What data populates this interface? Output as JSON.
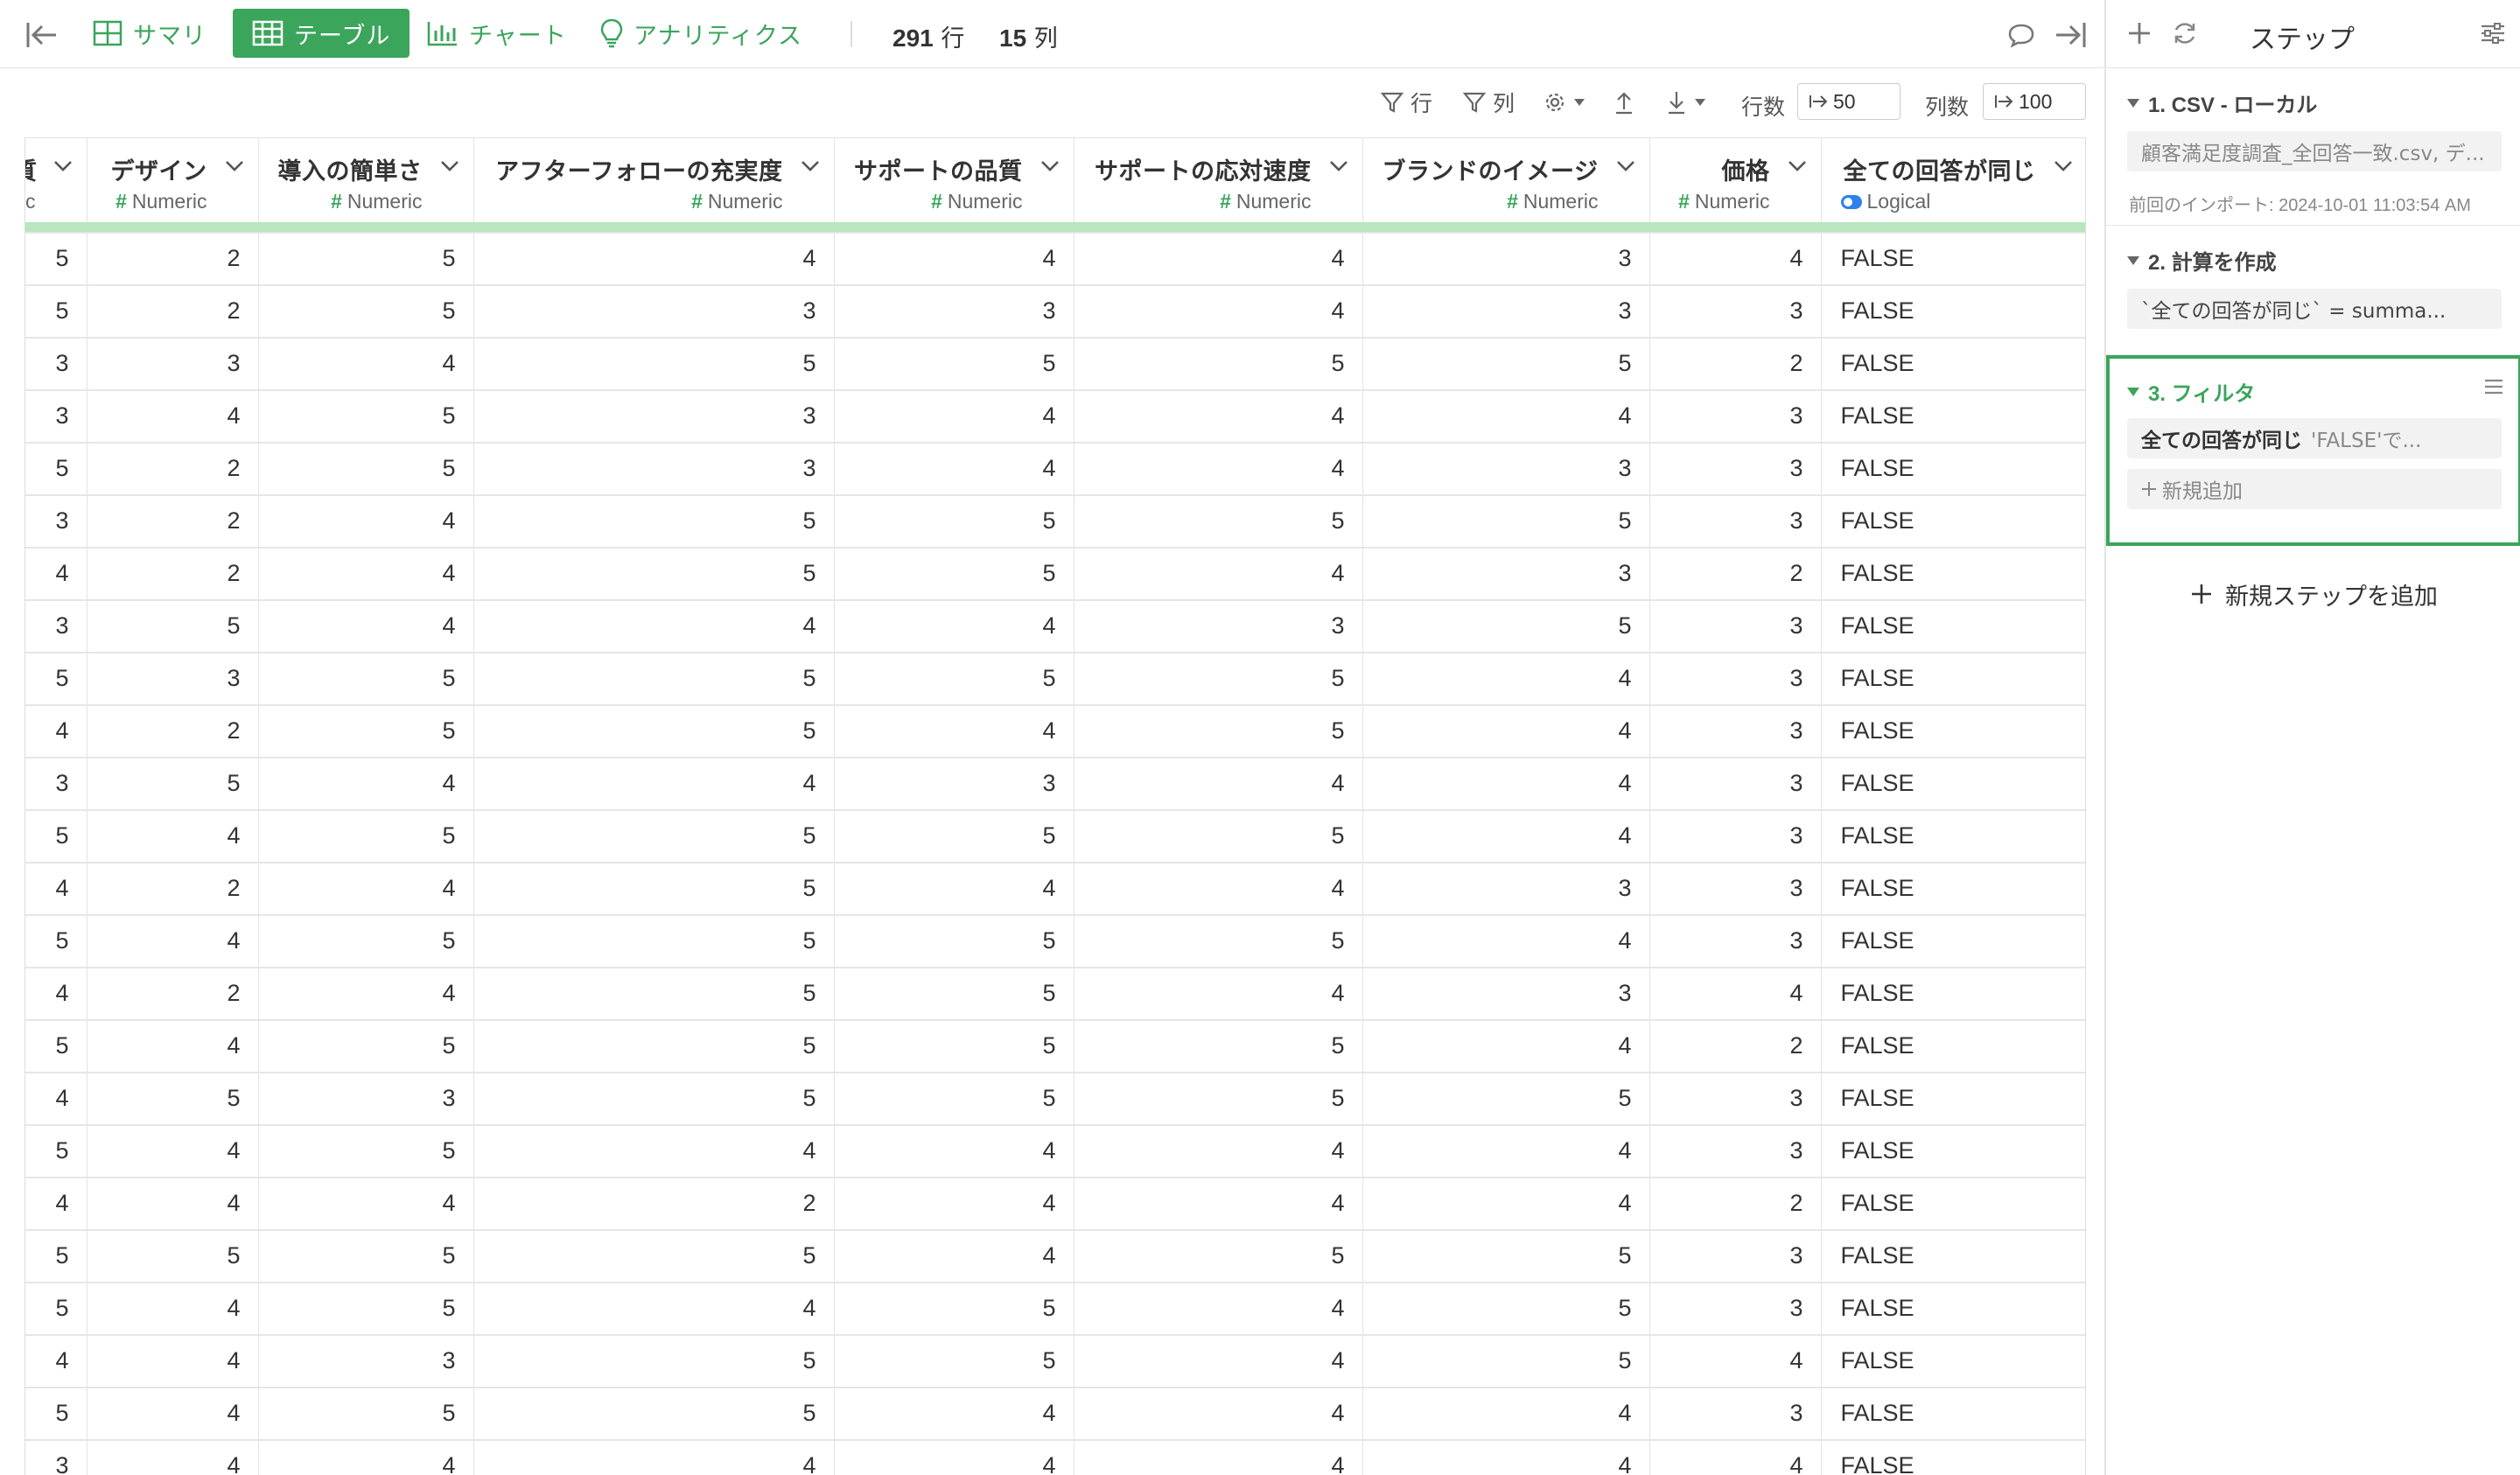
{
  "toolbar": {
    "tabs": [
      {
        "label": "サマリ",
        "icon": "grid-icon"
      },
      {
        "label": "テーブル",
        "icon": "table-icon"
      },
      {
        "label": "チャート",
        "icon": "bar-chart-icon"
      },
      {
        "label": "アナリティクス",
        "icon": "lightbulb-icon"
      }
    ],
    "row_count": "291",
    "row_unit": "行",
    "col_count": "15",
    "col_unit": "列",
    "accent_color": "#3aa55b"
  },
  "subtoolbar": {
    "filter_row_label": "行",
    "filter_col_label": "列",
    "rows_label": "行数",
    "rows_value": "50",
    "cols_label": "列数",
    "cols_value": "100"
  },
  "table": {
    "columns": [
      {
        "name": "質",
        "type": "c",
        "type_kind": "partial"
      },
      {
        "name": "デザイン",
        "type": "Numeric",
        "type_kind": "numeric"
      },
      {
        "name": "導入の簡単さ",
        "type": "Numeric",
        "type_kind": "numeric"
      },
      {
        "name": "アフターフォローの充実度",
        "type": "Numeric",
        "type_kind": "numeric"
      },
      {
        "name": "サポートの品質",
        "type": "Numeric",
        "type_kind": "numeric"
      },
      {
        "name": "サポートの応対速度",
        "type": "Numeric",
        "type_kind": "numeric"
      },
      {
        "name": "ブランドのイメージ",
        "type": "Numeric",
        "type_kind": "numeric"
      },
      {
        "name": "価格",
        "type": "Numeric",
        "type_kind": "numeric"
      },
      {
        "name": "全ての回答が同じ",
        "type": "Logical",
        "type_kind": "logical"
      }
    ],
    "rows": [
      [
        "5",
        "2",
        "5",
        "4",
        "4",
        "4",
        "3",
        "4",
        "FALSE"
      ],
      [
        "5",
        "2",
        "5",
        "3",
        "3",
        "4",
        "3",
        "3",
        "FALSE"
      ],
      [
        "3",
        "3",
        "4",
        "5",
        "5",
        "5",
        "5",
        "2",
        "FALSE"
      ],
      [
        "3",
        "4",
        "5",
        "3",
        "4",
        "4",
        "4",
        "3",
        "FALSE"
      ],
      [
        "5",
        "2",
        "5",
        "3",
        "4",
        "4",
        "3",
        "3",
        "FALSE"
      ],
      [
        "3",
        "2",
        "4",
        "5",
        "5",
        "5",
        "5",
        "3",
        "FALSE"
      ],
      [
        "4",
        "2",
        "4",
        "5",
        "5",
        "4",
        "3",
        "2",
        "FALSE"
      ],
      [
        "3",
        "5",
        "4",
        "4",
        "4",
        "3",
        "5",
        "3",
        "FALSE"
      ],
      [
        "5",
        "3",
        "5",
        "5",
        "5",
        "5",
        "4",
        "3",
        "FALSE"
      ],
      [
        "4",
        "2",
        "5",
        "5",
        "4",
        "5",
        "4",
        "3",
        "FALSE"
      ],
      [
        "3",
        "5",
        "4",
        "4",
        "3",
        "4",
        "4",
        "3",
        "FALSE"
      ],
      [
        "5",
        "4",
        "5",
        "5",
        "5",
        "5",
        "4",
        "3",
        "FALSE"
      ],
      [
        "4",
        "2",
        "4",
        "5",
        "4",
        "4",
        "3",
        "3",
        "FALSE"
      ],
      [
        "5",
        "4",
        "5",
        "5",
        "5",
        "5",
        "4",
        "3",
        "FALSE"
      ],
      [
        "4",
        "2",
        "4",
        "5",
        "5",
        "4",
        "3",
        "4",
        "FALSE"
      ],
      [
        "5",
        "4",
        "5",
        "5",
        "5",
        "5",
        "4",
        "2",
        "FALSE"
      ],
      [
        "4",
        "5",
        "3",
        "5",
        "5",
        "5",
        "5",
        "3",
        "FALSE"
      ],
      [
        "5",
        "4",
        "5",
        "4",
        "4",
        "4",
        "4",
        "3",
        "FALSE"
      ],
      [
        "4",
        "4",
        "4",
        "2",
        "4",
        "4",
        "4",
        "2",
        "FALSE"
      ],
      [
        "5",
        "5",
        "5",
        "5",
        "4",
        "5",
        "5",
        "3",
        "FALSE"
      ],
      [
        "5",
        "4",
        "5",
        "4",
        "5",
        "4",
        "5",
        "3",
        "FALSE"
      ],
      [
        "4",
        "4",
        "3",
        "5",
        "5",
        "4",
        "5",
        "4",
        "FALSE"
      ],
      [
        "5",
        "4",
        "5",
        "5",
        "4",
        "4",
        "4",
        "3",
        "FALSE"
      ],
      [
        "3",
        "4",
        "4",
        "4",
        "4",
        "4",
        "4",
        "4",
        "FALSE"
      ]
    ]
  },
  "panel": {
    "title": "ステップ",
    "steps": [
      {
        "title": "1. CSV - ローカル",
        "card": "顧客満足度調査_全回答一致.csv, デ...",
        "note": "前回のインポート: 2024-10-01 11:03:54 AM"
      },
      {
        "title": "2. 計算を作成",
        "card": "`全ての回答が同じ` = summa..."
      },
      {
        "title": "3. フィルタ",
        "card_strong": "全ての回答が同じ",
        "card_rest": "'FALSE'で...",
        "add_label": "新規追加"
      }
    ],
    "add_step_label": "新規ステップを追加"
  }
}
